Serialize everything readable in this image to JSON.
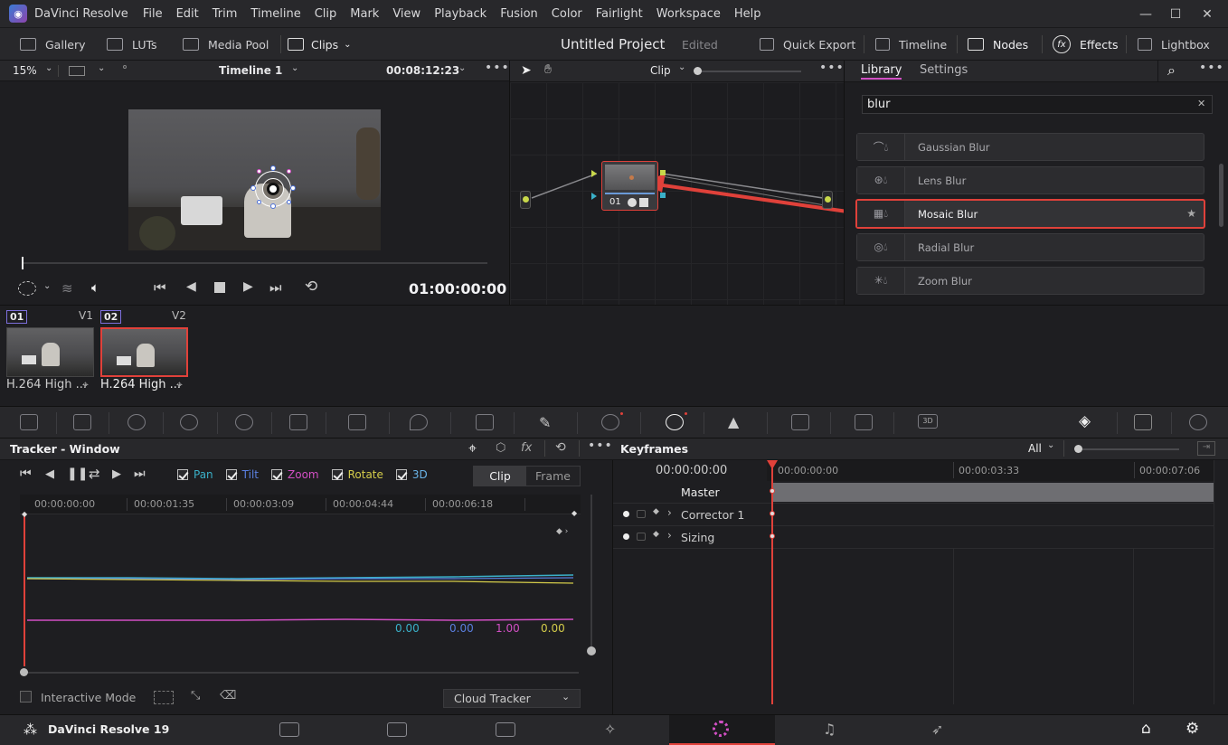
{
  "app": {
    "title": "DaVinci Resolve"
  },
  "menu": [
    "File",
    "Edit",
    "Trim",
    "Timeline",
    "Clip",
    "Mark",
    "View",
    "Playback",
    "Fusion",
    "Color",
    "Fairlight",
    "Workspace",
    "Help"
  ],
  "toolbar": {
    "gallery": "Gallery",
    "luts": "LUTs",
    "media_pool": "Media Pool",
    "clips": "Clips",
    "project_title": "Untitled Project",
    "project_status": "Edited",
    "quick_export": "Quick Export",
    "timeline": "Timeline",
    "nodes": "Nodes",
    "effects": "Effects",
    "lightbox": "Lightbox"
  },
  "viewer": {
    "zoom": "15%",
    "timeline_name": "Timeline 1",
    "timecode": "00:08:12:23",
    "playhead_timecode": "01:00:00:00"
  },
  "nodes": {
    "mode": "Clip",
    "node_label": "01"
  },
  "library": {
    "tabs": [
      "Library",
      "Settings"
    ],
    "search_value": "blur",
    "items": [
      {
        "name": "Gaussian Blur",
        "icon": "gaussian-blur-icon"
      },
      {
        "name": "Lens Blur",
        "icon": "lens-blur-icon"
      },
      {
        "name": "Mosaic Blur",
        "icon": "mosaic-blur-icon",
        "selected": true
      },
      {
        "name": "Radial Blur",
        "icon": "radial-blur-icon"
      },
      {
        "name": "Zoom Blur",
        "icon": "zoom-blur-icon"
      }
    ],
    "highlight_color": "#e0413a"
  },
  "clips": [
    {
      "index": "01",
      "track": "V1",
      "codec": "H.264 High ..."
    },
    {
      "index": "02",
      "track": "V2",
      "codec": "H.264 High ...",
      "selected": true
    }
  ],
  "tracker": {
    "title": "Tracker - Window",
    "checks": [
      {
        "label": "Pan",
        "color": "#3ab0c8"
      },
      {
        "label": "Tilt",
        "color": "#5a7fe0"
      },
      {
        "label": "Zoom",
        "color": "#d24fc4"
      },
      {
        "label": "Rotate",
        "color": "#d4cc4a"
      },
      {
        "label": "3D",
        "color": "#6ab4e8"
      }
    ],
    "view_tabs": [
      "Clip",
      "Frame"
    ],
    "ruler": [
      "00:00:00:00",
      "00:00:01:35",
      "00:00:03:09",
      "00:00:04:44",
      "00:00:06:18"
    ],
    "values": [
      {
        "value": "0.00",
        "color": "#3ab0c8"
      },
      {
        "value": "0.00",
        "color": "#5a7fe0"
      },
      {
        "value": "1.00",
        "color": "#d24fc4"
      },
      {
        "value": "0.00",
        "color": "#d4cc4a"
      }
    ],
    "interactive_mode": "Interactive Mode",
    "tracker_type": "Cloud Tracker"
  },
  "keyframes": {
    "title": "Keyframes",
    "filter": "All",
    "timecode": "00:00:00:00",
    "ruler": [
      "00:00:00:00",
      "00:00:03:33",
      "00:00:07:06"
    ],
    "tracks": [
      "Master",
      "Corrector 1",
      "Sizing"
    ]
  },
  "footer": {
    "app_version": "DaVinci Resolve 19"
  }
}
